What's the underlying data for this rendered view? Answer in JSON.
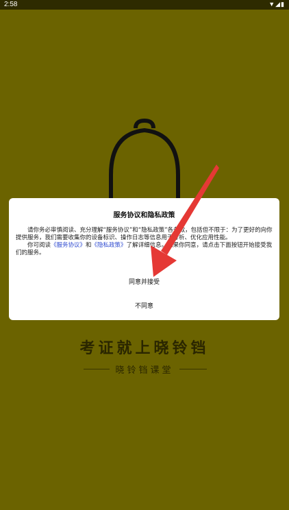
{
  "status_bar": {
    "time": "2:58",
    "icons": [
      "wifi-icon",
      "signal-icon",
      "battery-icon"
    ]
  },
  "splash": {
    "slogan": "考证就上晓铃铛",
    "brand": "晓铃铛课堂"
  },
  "dialog": {
    "title": "服务协议和隐私政策",
    "paragraph1": "请你务必审慎阅读、充分理解“服务协议”和“隐私政策”各条款，包括但不限于：为了更好的向你提供服务，我们需要收集你的设备标识、操作日志等信息用于分析、优化应用性能。",
    "p2_prefix": "你可阅读",
    "link_service": "《服务协议》",
    "p2_and": "和",
    "link_privacy": "《隐私政策》",
    "p2_suffix": "了解详细信息。如果你同意，请点击下面按钮开始接受我们的服务。",
    "agree_label": "同意并接受",
    "disagree_label": "不同意"
  },
  "colors": {
    "background": "#6b6300",
    "link": "#2f4bd0",
    "arrow": "#e53935"
  }
}
